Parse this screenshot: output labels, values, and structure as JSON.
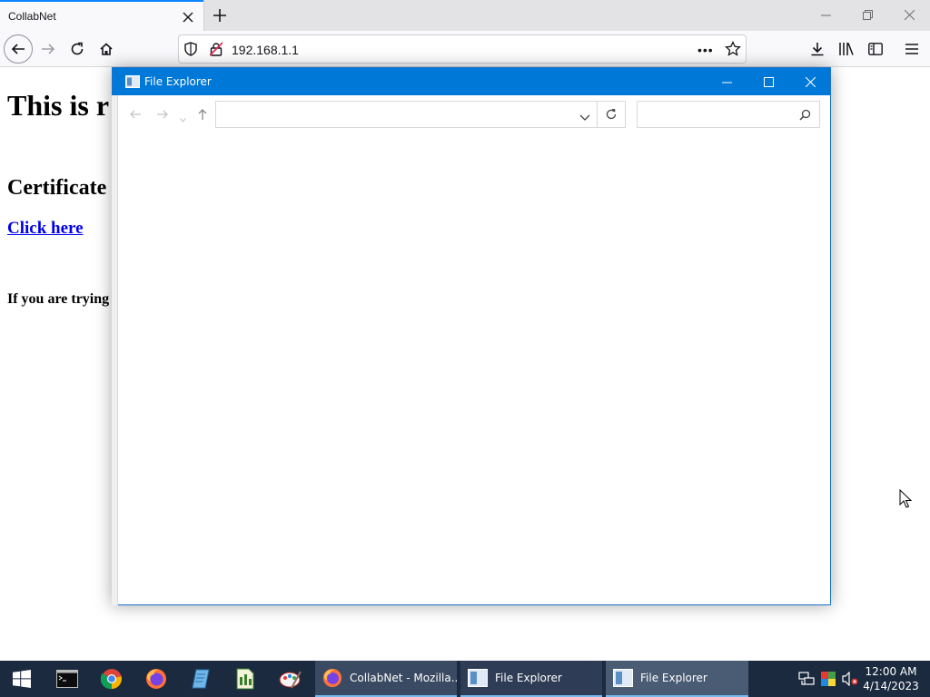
{
  "browser": {
    "tab_title": "CollabNet",
    "url": "192.168.1.1"
  },
  "page": {
    "heading": "This is r",
    "subheading": "Certificate",
    "link": "Click here",
    "text": "If you are trying"
  },
  "explorer": {
    "title": "File Explorer"
  },
  "taskbar": {
    "tasks": [
      {
        "label": "CollabNet - Mozilla..."
      },
      {
        "label": "File Explorer"
      },
      {
        "label": "File Explorer"
      }
    ],
    "clock_time": "12:00 AM",
    "clock_date": "4/14/2023"
  },
  "colors": {
    "accent": "#0078d7",
    "taskbar": "#1b2a3f",
    "link": "#0000ee"
  }
}
